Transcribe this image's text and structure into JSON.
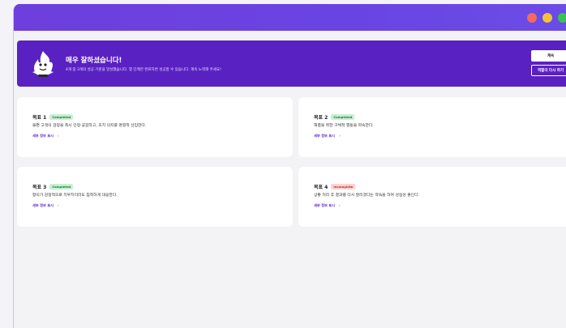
{
  "banner": {
    "title": "매우 잘하셨습니다!",
    "subtitle": "4개 중 3개의 성공 기준을 달성했습니다. 몇 단계만 완료하면 성공할 수 있습니다. 계속 노력해 주세요!",
    "continue_label": "계속",
    "retry_label": "역할극 다시 하기"
  },
  "goals": [
    {
      "title": "목표 1",
      "status": "Completed",
      "description": "불편 고객의 감정을 즉시 인정·공감하고, 조치 의지를 명령적 선입한다.",
      "link": "세부 정보 표시",
      "chevron": "›"
    },
    {
      "title": "목표 2",
      "status": "Completed",
      "description": "해결을 위한 구체적 행동을 약속한다.",
      "link": "세부 정보 표시",
      "chevron": "›"
    },
    {
      "title": "목표 3",
      "status": "Completed",
      "description": "항의가 감정적으로 치우치더라도 침착하게 대응한다.",
      "link": "세부 정보 표시",
      "chevron": "›"
    },
    {
      "title": "목표 4",
      "status": "Incomplete",
      "description": "상황 처리 후 결과를 다시 알리겠다는 약속을 하여 성실성 좋인다.",
      "link": "세부 정보 표시",
      "chevron": "›"
    }
  ],
  "colors": {
    "titlebar": "#6b44e2",
    "banner": "#5a21c2",
    "completed_bg": "#c9efd3",
    "incomplete_bg": "#fbd3d3",
    "link": "#5a2dd0"
  },
  "icons": {
    "mascot": "flame-mascot-icon",
    "chevron": "chevron-right-icon"
  }
}
